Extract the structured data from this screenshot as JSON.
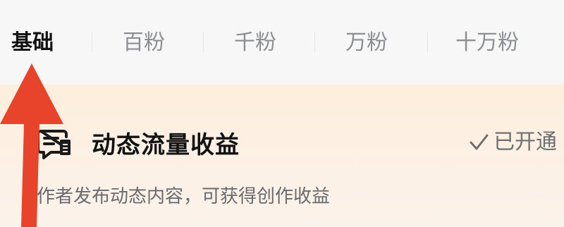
{
  "tabs": [
    {
      "label": "基础",
      "active": true
    },
    {
      "label": "百粉",
      "active": false
    },
    {
      "label": "千粉",
      "active": false
    },
    {
      "label": "万粉",
      "active": false
    },
    {
      "label": "十万粉",
      "active": false
    }
  ],
  "card": {
    "title": "动态流量收益",
    "status": "已开通",
    "description": "作者发布动态内容，可获得创作收益",
    "icon": "message-doc-icon"
  },
  "colors": {
    "accent_arrow": "#e8442b",
    "card_bg": "#fdeedd",
    "active_tab": "#121212",
    "inactive_tab": "#8e8f93"
  },
  "annotation": {
    "icon": "up-arrow-icon"
  }
}
